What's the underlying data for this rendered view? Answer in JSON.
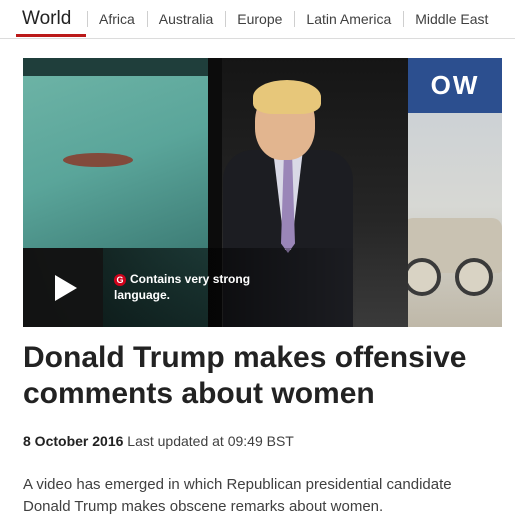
{
  "nav": {
    "section": "World",
    "items": [
      "Africa",
      "Australia",
      "Europe",
      "Latin America",
      "Middle East"
    ],
    "accent_color": "#bb1919"
  },
  "media": {
    "play_icon": "play-icon",
    "warning_badge": "G",
    "warning_text": "Contains very strong language.",
    "warning_badge_color": "#d0021b",
    "background_sign_text": "OW"
  },
  "article": {
    "headline": "Donald Trump makes offensive comments about women",
    "date": "8 October 2016",
    "last_updated": "Last updated at 09:49 BST",
    "summary": "A video has emerged in which Republican presidential candidate Donald Trump makes obscene remarks about women."
  }
}
